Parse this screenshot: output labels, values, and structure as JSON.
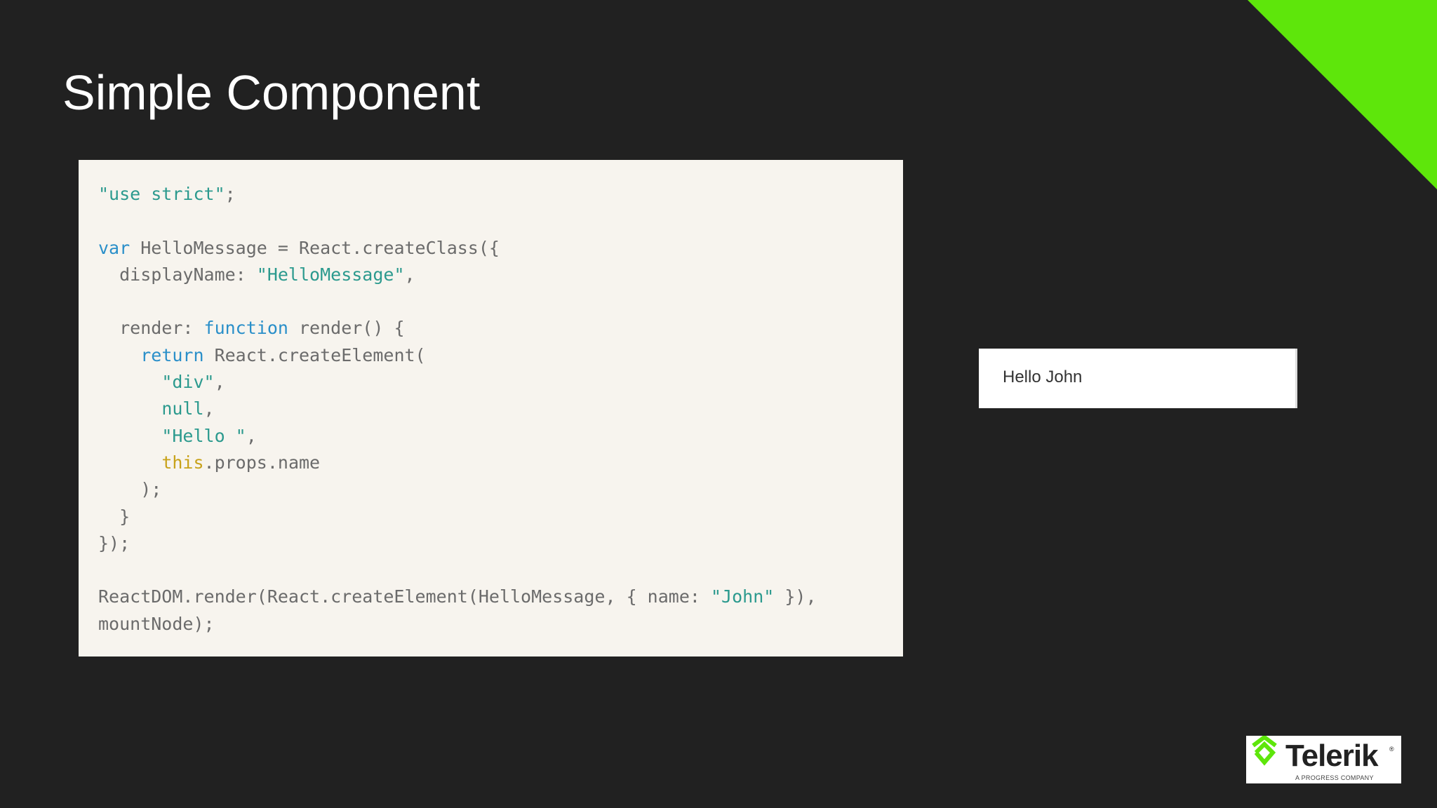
{
  "slide": {
    "title": "Simple Component",
    "accent_color": "#5ee60b",
    "background": "#212121"
  },
  "code_lines": [
    [
      {
        "t": "\"use strict\"",
        "c": "s"
      },
      {
        "t": ";",
        "c": "p"
      }
    ],
    [],
    [
      {
        "t": "var",
        "c": "k"
      },
      {
        "t": " HelloMessage = React.createClass({",
        "c": "p"
      }
    ],
    [
      {
        "t": "  displayName: ",
        "c": "p"
      },
      {
        "t": "\"HelloMessage\"",
        "c": "s"
      },
      {
        "t": ",",
        "c": "p"
      }
    ],
    [],
    [
      {
        "t": "  render: ",
        "c": "p"
      },
      {
        "t": "function",
        "c": "k"
      },
      {
        "t": " render() {",
        "c": "p"
      }
    ],
    [
      {
        "t": "    ",
        "c": "p"
      },
      {
        "t": "return",
        "c": "k"
      },
      {
        "t": " React.createElement(",
        "c": "p"
      }
    ],
    [
      {
        "t": "      ",
        "c": "p"
      },
      {
        "t": "\"div\"",
        "c": "s"
      },
      {
        "t": ",",
        "c": "p"
      }
    ],
    [
      {
        "t": "      ",
        "c": "p"
      },
      {
        "t": "null",
        "c": "n"
      },
      {
        "t": ",",
        "c": "p"
      }
    ],
    [
      {
        "t": "      ",
        "c": "p"
      },
      {
        "t": "\"Hello \"",
        "c": "s"
      },
      {
        "t": ",",
        "c": "p"
      }
    ],
    [
      {
        "t": "      ",
        "c": "p"
      },
      {
        "t": "this",
        "c": "t"
      },
      {
        "t": ".props.name",
        "c": "p"
      }
    ],
    [
      {
        "t": "    );",
        "c": "p"
      }
    ],
    [
      {
        "t": "  }",
        "c": "p"
      }
    ],
    [
      {
        "t": "});",
        "c": "p"
      }
    ],
    [],
    [
      {
        "t": "ReactDOM.render(React.createElement(HelloMessage, { name: ",
        "c": "p"
      },
      {
        "t": "\"John\"",
        "c": "s"
      },
      {
        "t": " }),",
        "c": "p"
      }
    ],
    [
      {
        "t": "mountNode);",
        "c": "p"
      }
    ]
  ],
  "output": {
    "text": "Hello John"
  },
  "logo": {
    "name": "Telerik",
    "trademark": "®",
    "tagline": "A PROGRESS COMPANY"
  }
}
